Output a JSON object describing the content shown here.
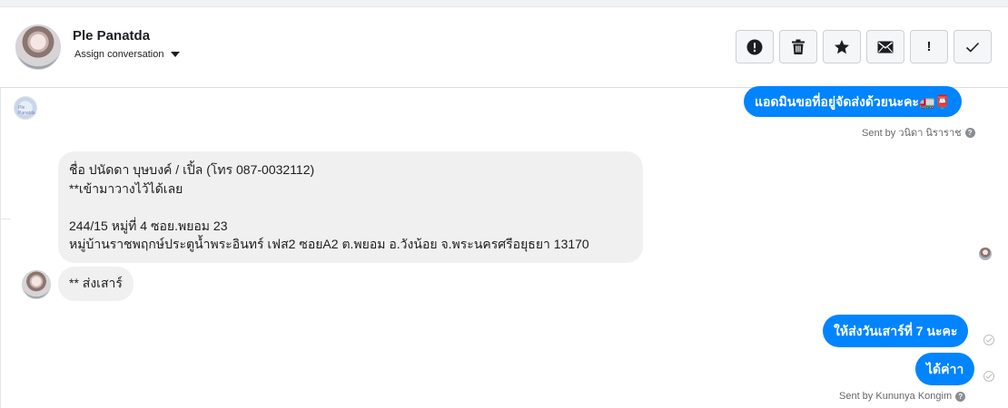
{
  "header": {
    "contact_name": "Ple Panatda",
    "assign_label": "Assign conversation"
  },
  "toolbar": {
    "buttons": [
      {
        "name": "mark-spam",
        "icon": "alert-circle-icon"
      },
      {
        "name": "delete",
        "icon": "trash-icon"
      },
      {
        "name": "star",
        "icon": "star-icon"
      },
      {
        "name": "mark-unread",
        "icon": "envelope-icon"
      },
      {
        "name": "follow-up",
        "icon": "exclamation-icon",
        "label": "!"
      },
      {
        "name": "mark-done",
        "icon": "check-icon"
      }
    ]
  },
  "messages": [
    {
      "direction": "out",
      "text": "แอดมินขอที่อยู่จัดส่งด้วยนะคะ🚛📮"
    },
    {
      "type": "sent_by",
      "text": "Sent by วนิดา นิราราช"
    },
    {
      "direction": "in",
      "lines": [
        "ชื่อ ปนัดดา บุษบงค์ / เปิ้ล (โทร 087-0032112)",
        "**เข้ามาวางไว้ได้เลย",
        "",
        "244/15 หมู่ที่ 4 ซอย.พยอม 23",
        "หมู่บ้านราชพฤกษ์ประตูน้ำพระอินทร์ เฟส2 ซอยA2 ต.พยอม อ.วังน้อย จ.พระนครศรีอยุธยา 13170"
      ]
    },
    {
      "direction": "in",
      "text": "** ส่งเสาร์"
    },
    {
      "direction": "out",
      "text": "ให้ส่งวันเสาร์ที่ 7 นะคะ"
    },
    {
      "direction": "out",
      "text": "ได้ค่าา"
    },
    {
      "type": "sent_by",
      "text": "Sent by Kununya Kongim"
    }
  ],
  "colors": {
    "outgoing_bubble": "#0084ff",
    "incoming_bubble": "#f0f0f0",
    "meta_text": "#65676b"
  }
}
